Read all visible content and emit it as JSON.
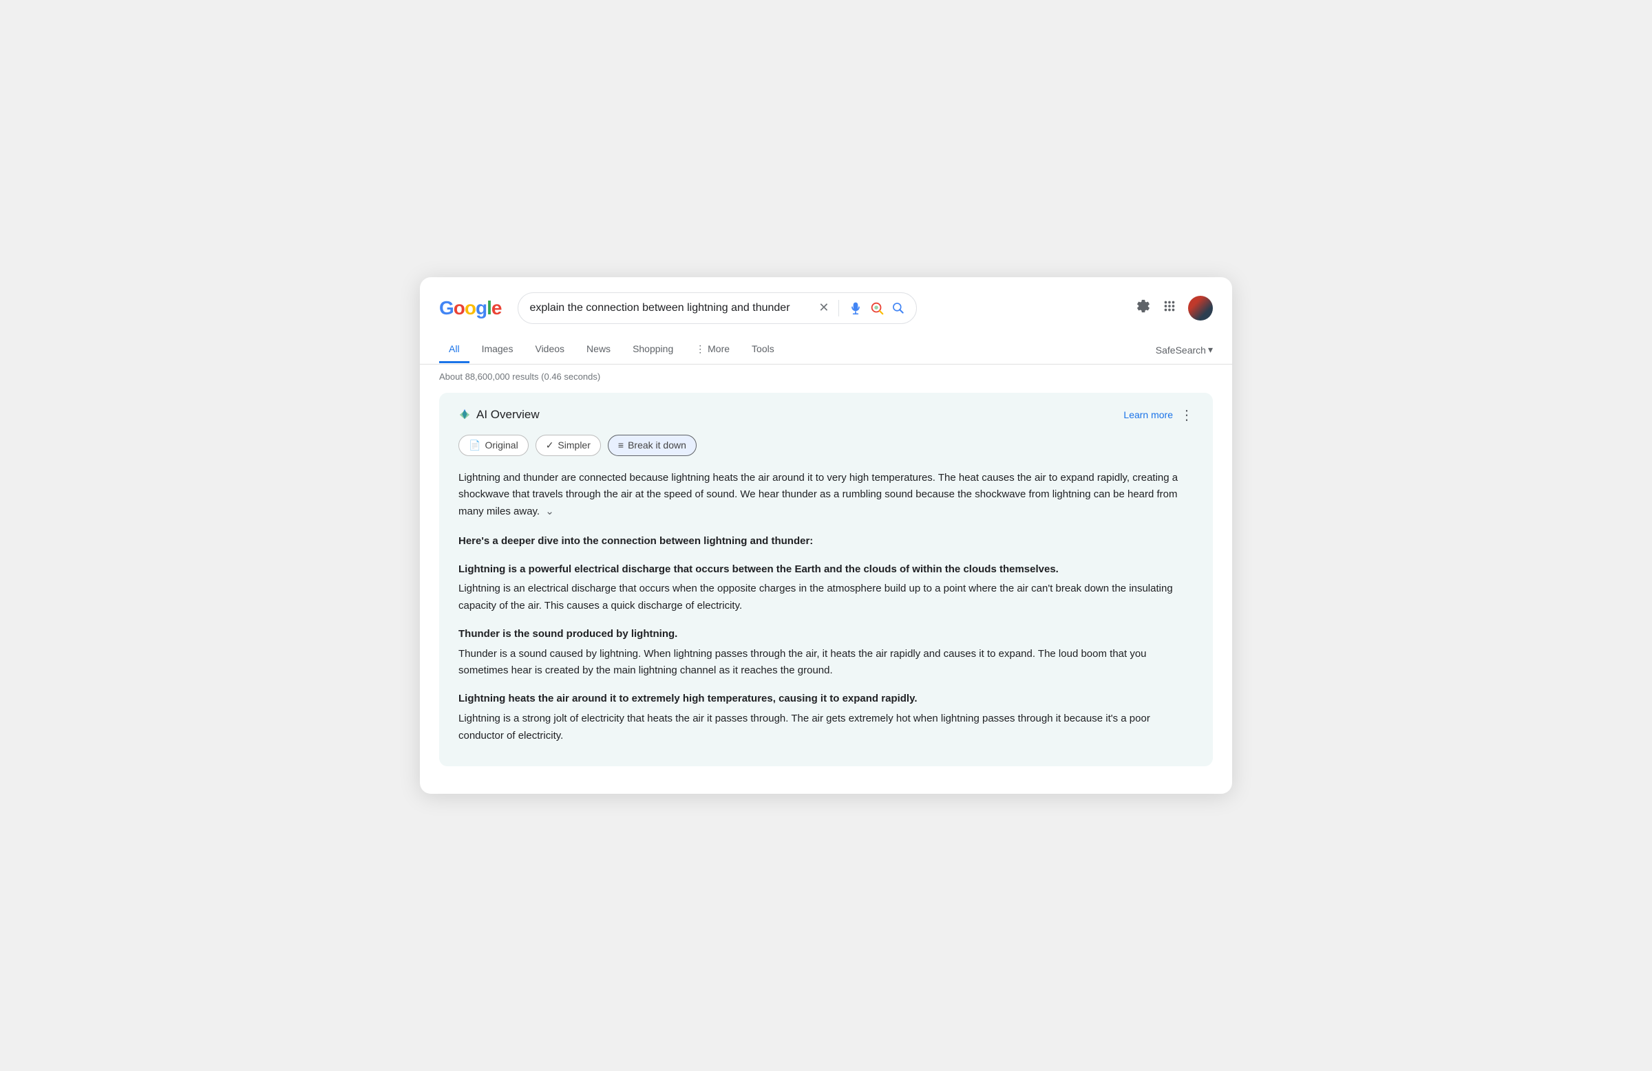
{
  "logo": {
    "letters": [
      {
        "char": "G",
        "class": "logo-G"
      },
      {
        "char": "o",
        "class": "logo-o1"
      },
      {
        "char": "o",
        "class": "logo-o2"
      },
      {
        "char": "g",
        "class": "logo-g"
      },
      {
        "char": "l",
        "class": "logo-l"
      },
      {
        "char": "e",
        "class": "logo-e"
      }
    ]
  },
  "search": {
    "query": "explain the connection between lightning and thunder",
    "placeholder": "Search"
  },
  "nav": {
    "tabs": [
      "All",
      "Images",
      "Videos",
      "News",
      "Shopping",
      "More"
    ],
    "tools": "Tools",
    "safesearch": "SafeSearch"
  },
  "results": {
    "count": "About 88,600,000 results (0.46 seconds)"
  },
  "ai_overview": {
    "title": "AI Overview",
    "learn_more": "Learn more",
    "pills": [
      {
        "label": "Original",
        "icon": "📄",
        "active": false
      },
      {
        "label": "Simpler",
        "icon": "✓",
        "active": false
      },
      {
        "label": "Break it down",
        "icon": "≡",
        "active": true
      }
    ],
    "intro": "Lightning and thunder are connected because lightning heats the air around it to very high temperatures. The heat causes the air to expand rapidly, creating a shockwave that travels through the air at the speed of sound. We hear thunder as a rumbling sound because the shockwave from lightning can be heard from many miles away.",
    "section_title": "Here's a deeper dive into the connection between lightning and thunder:",
    "subsections": [
      {
        "title": "Lightning is a powerful electrical discharge that occurs between the Earth and the clouds of within the clouds themselves.",
        "body": "Lightning is an electrical discharge that occurs when the opposite charges in the atmosphere build up to a point where the air can't break down the insulating capacity of the air. This causes a quick discharge of electricity."
      },
      {
        "title": "Thunder is the sound produced by lightning.",
        "body": "Thunder is a sound caused by lightning. When lightning passes through the air, it heats the air rapidly and causes it to expand. The loud boom that you sometimes hear is created by the main lightning channel as it reaches the ground."
      },
      {
        "title": "Lightning heats the air around it to extremely high temperatures, causing it to expand rapidly.",
        "body": "Lightning is a strong jolt of electricity that heats the air it passes through. The air gets extremely hot when lightning passes through it because it's a poor conductor of electricity."
      }
    ]
  }
}
